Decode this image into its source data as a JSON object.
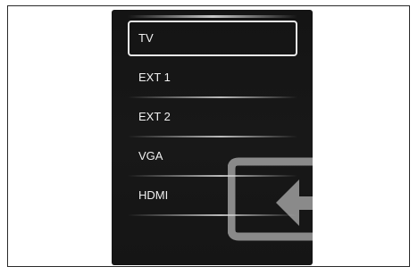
{
  "menu": {
    "selected_index": 0,
    "items": [
      {
        "label": "TV"
      },
      {
        "label": "EXT 1"
      },
      {
        "label": "EXT 2"
      },
      {
        "label": "VGA"
      },
      {
        "label": "HDMI"
      }
    ]
  },
  "icons": {
    "source": "input-source-icon"
  },
  "colors": {
    "panel": "#151515",
    "text": "#f0f0f0",
    "icon": "#8a8a8a"
  }
}
